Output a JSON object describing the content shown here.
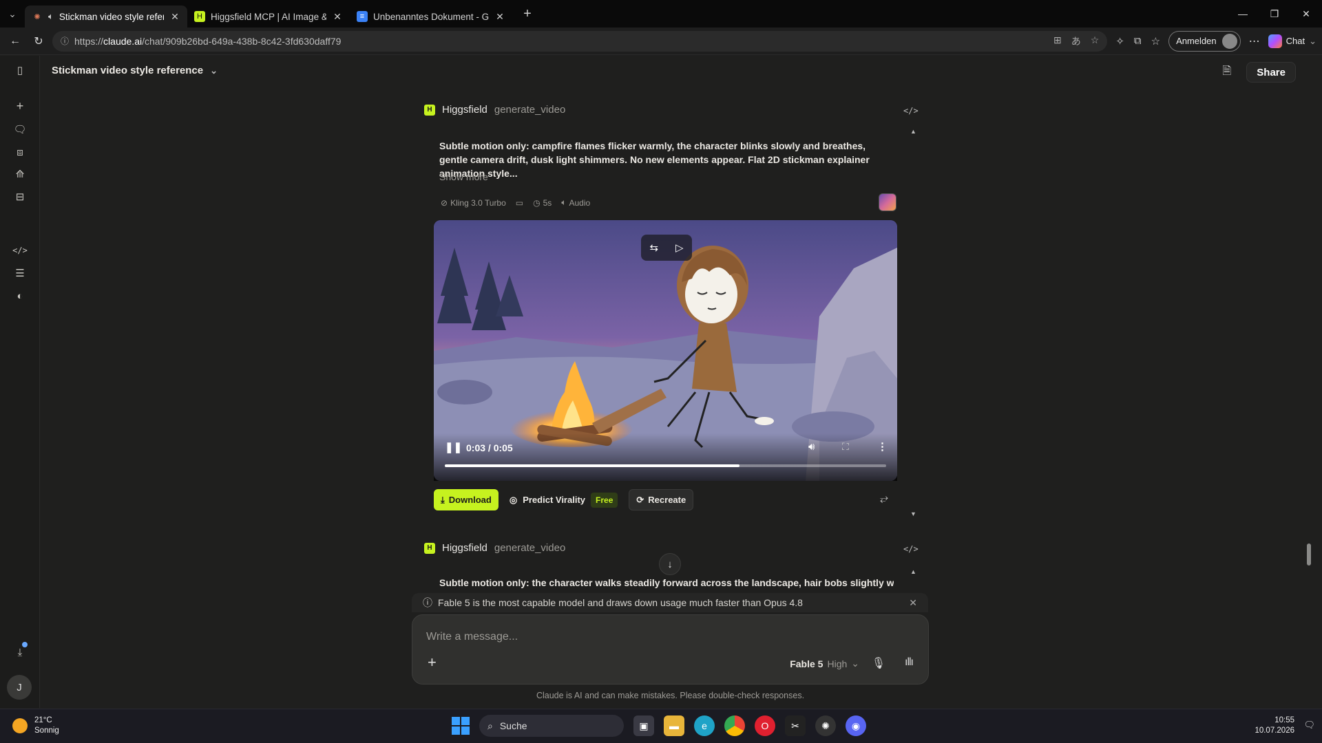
{
  "browser": {
    "tabs": [
      {
        "title": "Stickman video style reference",
        "active": true
      },
      {
        "title": "Higgsfield MCP | AI Image & Video",
        "active": false
      },
      {
        "title": "Unbenanntes Dokument - Google Docs",
        "active": false
      }
    ],
    "url_prefix": "https://",
    "url_host": "claude.ai",
    "url_path": "/chat/909b26bd-649a-438b-8c42-3fd630daff79",
    "signin_label": "Anmelden",
    "chat_label": "Chat"
  },
  "header": {
    "title": "Stickman video style reference",
    "share_label": "Share"
  },
  "tool1": {
    "name": "Higgsfield",
    "fn": "generate_video",
    "prompt": "Subtle motion only: campfire flames flicker warmly, the character blinks slowly and breathes, gentle camera drift, dusk light shimmers. No new elements appear. Flat 2D stickman explainer animation style...",
    "show_more": "Show more",
    "meta": {
      "model": "Kling 3.0 Turbo",
      "duration": "5s",
      "audio": "Audio"
    },
    "video": {
      "time": "0:03 / 0:05",
      "progress": 0.667
    },
    "actions": {
      "download": "Download",
      "predict": "Predict Virality",
      "free": "Free",
      "recreate": "Recreate"
    }
  },
  "tool2": {
    "name": "Higgsfield",
    "fn": "generate_video",
    "prompt": "Subtle motion only: the character walks steadily forward across the landscape, hair bobs slightly with each"
  },
  "notice": "Fable 5 is the most capable model and draws down usage much faster than Opus 4.8",
  "composer": {
    "placeholder": "Write a message...",
    "model": "Fable 5",
    "effort": "High"
  },
  "disclaimer": "Claude is AI and can make mistakes. Please double-check responses.",
  "rail": {
    "avatar": "J"
  },
  "taskbar": {
    "temp": "21°C",
    "weather": "Sonnig",
    "search": "Suche",
    "time": "10:55",
    "date": "10.07.2026"
  }
}
